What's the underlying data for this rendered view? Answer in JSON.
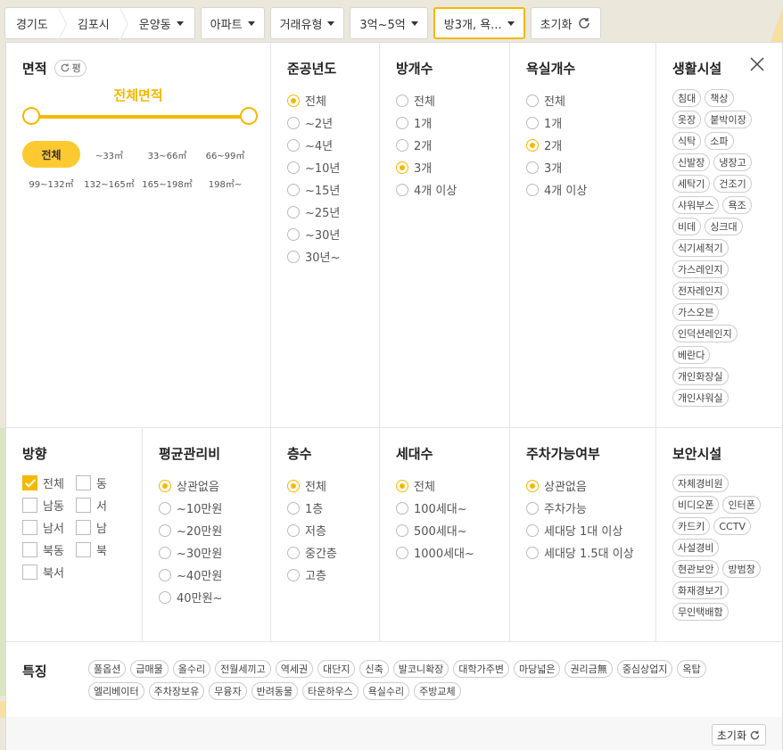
{
  "topbar": {
    "breadcrumbs": [
      "경기도",
      "김포시",
      "운양동"
    ],
    "chips": [
      "아파트",
      "거래유형",
      "3억~5억",
      "방3개, 욕..."
    ],
    "reset_label": "초기화"
  },
  "area": {
    "title": "면적",
    "unit_toggle": "평",
    "range_label": "전체면적",
    "options": [
      "전체",
      "~33㎡",
      "33~66㎡",
      "66~99㎡",
      "99~132㎡",
      "132~165㎡",
      "165~198㎡",
      "198㎡~"
    ],
    "selected": "전체"
  },
  "built_year": {
    "title": "준공년도",
    "options": [
      "전체",
      "~2년",
      "~4년",
      "~10년",
      "~15년",
      "~25년",
      "~30년",
      "30년~"
    ],
    "selected": "전체"
  },
  "rooms": {
    "title": "방개수",
    "options": [
      "전체",
      "1개",
      "2개",
      "3개",
      "4개 이상"
    ],
    "selected": "3개"
  },
  "baths": {
    "title": "욕실개수",
    "options": [
      "전체",
      "1개",
      "2개",
      "3개",
      "4개 이상"
    ],
    "selected": "2개"
  },
  "living": {
    "title": "생활시설",
    "tags": [
      "침대",
      "책상",
      "옷장",
      "붙박이장",
      "식탁",
      "소파",
      "신발장",
      "냉장고",
      "세탁기",
      "건조기",
      "샤워부스",
      "욕조",
      "비데",
      "싱크대",
      "식기세척기",
      "가스레인지",
      "전자레인지",
      "가스오븐",
      "인덕션레인지",
      "베란다",
      "개인화장실",
      "개인샤워실"
    ]
  },
  "direction": {
    "title": "방향",
    "options": [
      "전체",
      "동",
      "남동",
      "서",
      "남서",
      "남",
      "북동",
      "북",
      "북서"
    ],
    "selected": "전체"
  },
  "maint_fee": {
    "title": "평균관리비",
    "options": [
      "상관없음",
      "~10만원",
      "~20만원",
      "~30만원",
      "~40만원",
      "40만원~"
    ],
    "selected": "상관없음"
  },
  "floor": {
    "title": "층수",
    "options": [
      "전체",
      "1층",
      "저층",
      "중간층",
      "고층"
    ],
    "selected": "전체"
  },
  "households": {
    "title": "세대수",
    "options": [
      "전체",
      "100세대~",
      "500세대~",
      "1000세대~"
    ],
    "selected": "전체"
  },
  "parking": {
    "title": "주차가능여부",
    "options": [
      "상관없음",
      "주차가능",
      "세대당 1대 이상",
      "세대당 1.5대 이상"
    ],
    "selected": "상관없음"
  },
  "security": {
    "title": "보안시설",
    "tags": [
      "자체경비원",
      "비디오폰",
      "인터폰",
      "카드키",
      "CCTV",
      "사설경비",
      "현관보안",
      "방범창",
      "화재경보기",
      "무인택배함"
    ]
  },
  "features": {
    "title": "특징",
    "tags": [
      "풀옵션",
      "급매물",
      "올수리",
      "전월세끼고",
      "역세권",
      "대단지",
      "신축",
      "발코니확장",
      "대학가주변",
      "마당넓은",
      "권리금無",
      "중심상업지",
      "옥탑",
      "엘리베이터",
      "주차장보유",
      "무융자",
      "반려동물",
      "타운하우스",
      "욕실수리",
      "주방교체"
    ]
  },
  "footer": {
    "reset_label": "초기화"
  },
  "colors": {
    "accent": "#f5b800",
    "accent_fill": "#fcc931"
  }
}
